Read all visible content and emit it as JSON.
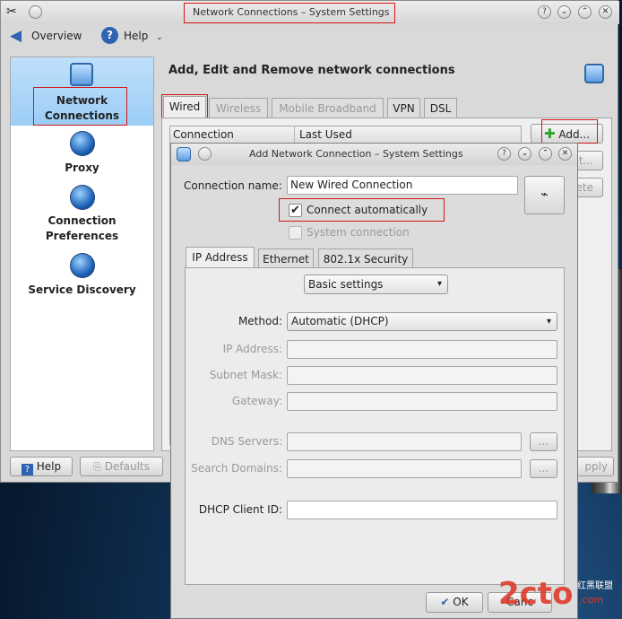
{
  "main_window": {
    "title": "Network Connections – System Settings",
    "toolbar": {
      "overview": "Overview",
      "help": "Help"
    },
    "sidebar": [
      {
        "label": "Network Connections",
        "selected": true
      },
      {
        "label": "Proxy"
      },
      {
        "label": "Connection Preferences"
      },
      {
        "label": "Service Discovery"
      }
    ],
    "heading": "Add, Edit and Remove network connections",
    "tabs": [
      {
        "label": "Wired",
        "active": true
      },
      {
        "label": "Wireless",
        "disabled": true
      },
      {
        "label": "Mobile Broadband",
        "disabled": true
      },
      {
        "label": "VPN"
      },
      {
        "label": "DSL"
      }
    ],
    "table": {
      "columns": [
        "Connection",
        "Last Used"
      ]
    },
    "buttons": {
      "add": "Add...",
      "edit_partial": "t...",
      "delete_partial": "ete"
    },
    "footer": {
      "help": "Help",
      "defaults": "Defaults",
      "apply_partial": "pply"
    }
  },
  "dialog": {
    "title": "Add Network Connection – System Settings",
    "connection_name_label": "Connection name:",
    "connection_name_value": "New Wired Connection",
    "connect_automatically": {
      "label": "Connect automatically",
      "checked": true
    },
    "system_connection": {
      "label": "System connection",
      "checked": false
    },
    "tabs": [
      {
        "label": "IP Address",
        "active": true
      },
      {
        "label": "Ethernet"
      },
      {
        "label": "802.1x Security"
      }
    ],
    "settings_mode": "Basic settings",
    "method_label": "Method:",
    "method_value": "Automatic (DHCP)",
    "ip_address_label": "IP Address:",
    "subnet_mask_label": "Subnet Mask:",
    "gateway_label": "Gateway:",
    "dns_servers_label": "DNS Servers:",
    "search_domains_label": "Search Domains:",
    "dhcp_client_id_label": "DHCP Client ID:",
    "ellipsis": "...",
    "ok": "OK",
    "cancel_partial": "Canc"
  },
  "watermark": {
    "main": "2cto",
    "sub": ".com",
    "cn": "红黑联盟"
  },
  "colors": {
    "annotation_red": "#d31717",
    "selection_blue": "#9ccdf5"
  }
}
